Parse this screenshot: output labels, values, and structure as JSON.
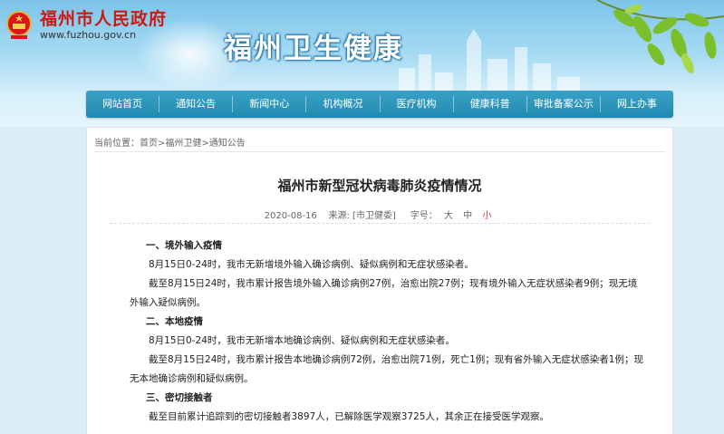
{
  "header": {
    "site_name": "福州市人民政府",
    "site_url": "www.fuzhou.gov.cn",
    "brand_title": "福州卫生健康"
  },
  "nav": {
    "items": [
      "网站首页",
      "通知公告",
      "新闻中心",
      "机构概况",
      "医疗机构",
      "健康科普",
      "审批备案公示",
      "网上办事"
    ]
  },
  "breadcrumb": {
    "prefix": "当前位置：",
    "items": [
      "首页",
      "福州卫健",
      "通知公告"
    ],
    "separator": ">"
  },
  "article": {
    "title": "福州市新型冠状病毒肺炎疫情情况",
    "date": "2020-08-16",
    "source": "来源: [市卫健委]",
    "font_size_label": "字号：",
    "font_sizes": [
      "大",
      "中",
      "小"
    ],
    "active_font_size": "小",
    "sections": [
      {
        "heading": "一、境外输入疫情",
        "paragraphs": [
          "8月15日0-24时，我市无新增境外输入确诊病例、疑似病例和无症状感染者。",
          "截至8月15日24时，我市累计报告境外输入确诊病例27例，治愈出院27例；现有境外输入无症状感染者9例；现无境外输入疑似病例。"
        ]
      },
      {
        "heading": "二、本地疫情",
        "paragraphs": [
          "8月15日0-24时，我市无新增本地确诊病例、疑似病例和无症状感染者。",
          "截至8月15日24时，我市累计报告本地确诊病例72例，治愈出院71例，死亡1例；现有省外输入无症状感染者1例；现无本地确诊病例和疑似病例。"
        ]
      },
      {
        "heading": "三、密切接触者",
        "paragraphs": [
          "截至目前累计追踪到的密切接触者3897人，已解除医学观察3725人，其余正在接受医学观察。"
        ]
      }
    ]
  },
  "colors": {
    "nav_bg": "#2a92b8",
    "site_name": "#c81c12",
    "active_font": "#dd3333"
  }
}
